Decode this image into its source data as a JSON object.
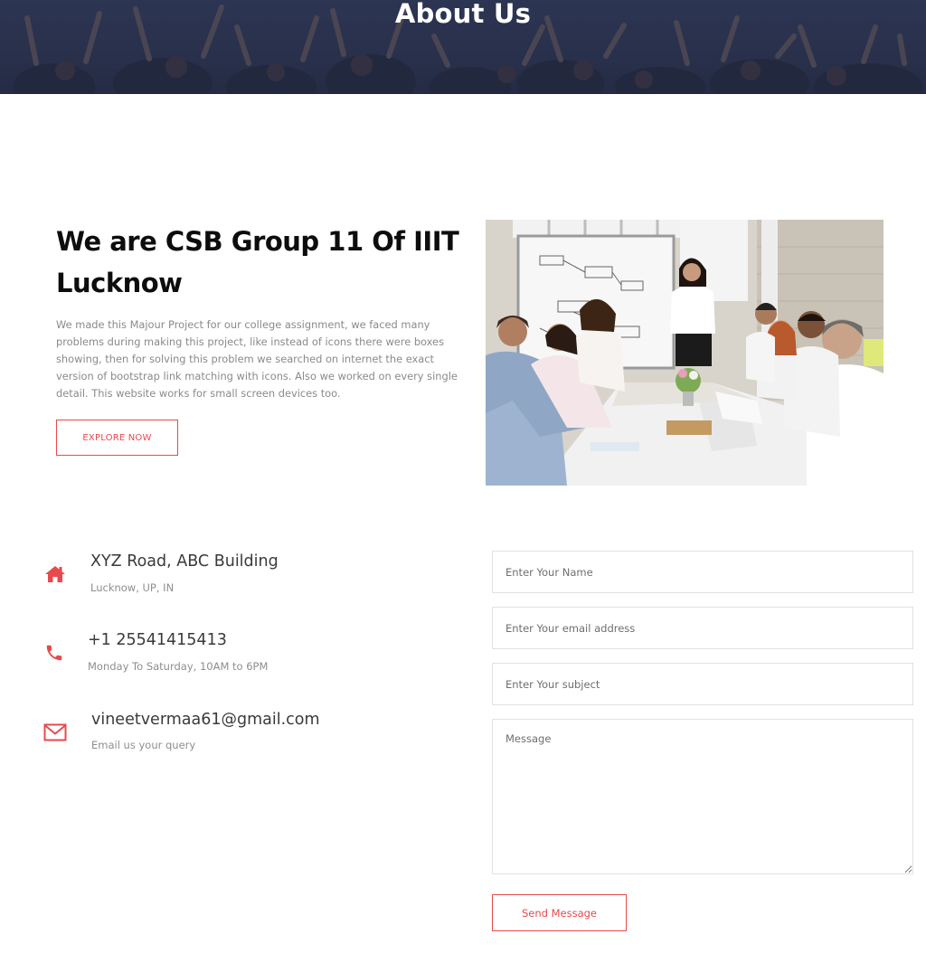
{
  "hero": {
    "title": "About Us"
  },
  "about": {
    "heading": "We are CSB Group 11 Of IIIT Lucknow",
    "description": "We made this Majour Project for our college assignment, we faced many problems during making this project, like instead of icons there were boxes showing, then for solving this problem we searched on internet the exact version of bootstrap link matching with icons. Also we worked on every single detail. This website works for small screen devices too.",
    "explore_label": "EXPLORE NOW",
    "image_icon": "meeting-photo"
  },
  "contact_info": {
    "address": {
      "icon": "home-icon",
      "title": "XYZ Road, ABC Building",
      "sub": "Lucknow, UP, IN"
    },
    "phone": {
      "icon": "phone-icon",
      "title": "+1 25541415413",
      "sub": "Monday To Saturday, 10AM to 6PM"
    },
    "email": {
      "icon": "envelope-icon",
      "title": "vineetvermaa61@gmail.com",
      "sub": "Email us your query"
    }
  },
  "form": {
    "name_placeholder": "Enter Your Name",
    "email_placeholder": "Enter Your email address",
    "subject_placeholder": "Enter Your subject",
    "message_placeholder": "Message",
    "send_label": "Send Message"
  },
  "colors": {
    "accent": "#e8494d",
    "hero_bg": "#262d47",
    "heading": "#0d0d0d",
    "body_text": "#8a8a8a"
  }
}
